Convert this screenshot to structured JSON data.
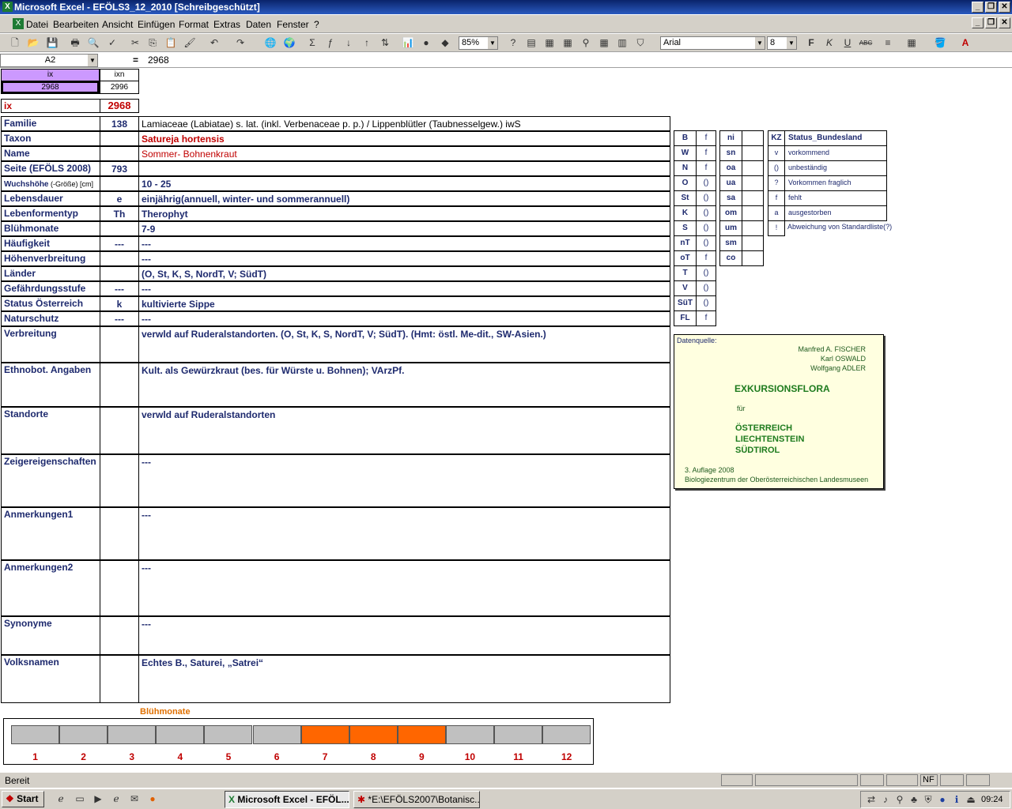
{
  "window": {
    "title": "Microsoft Excel - EFÖLS3_12_2010  [Schreibgeschützt]"
  },
  "menu": [
    "Datei",
    "Bearbeiten",
    "Ansicht",
    "Einfügen",
    "Format",
    "Extras",
    "Daten",
    "Fenster",
    "?"
  ],
  "toolbar": {
    "zoom": "85%",
    "font": "Arial",
    "size": "8"
  },
  "formula": {
    "cellref": "A2",
    "eq": "=",
    "value": "2968"
  },
  "header": {
    "ix_label": "ix",
    "ixn_label": "ixn",
    "ix_val": "2968",
    "ixn_val": "2996",
    "ix_row_label": "ix",
    "ix_row_val": "2968"
  },
  "rows": [
    {
      "label": "Familie",
      "code": "138",
      "value": "Lamiaceae (Labiatae) s. lat. (inkl. Verbenaceae p. p.)  /  Lippenblütler (Taubnesselgew.) iwS"
    },
    {
      "label": "Taxon",
      "code": "",
      "value": "Satureja hortensis"
    },
    {
      "label": "Name",
      "code": "",
      "value": "Sommer- Bohnenkraut"
    },
    {
      "label": "Seite (EFÖLS 2008)",
      "code": "793",
      "value": ""
    },
    {
      "label": "Wuchshöhe",
      "label_suffix": " (-Größe) [cm]",
      "code": "",
      "value": " 10 - 25"
    },
    {
      "label": "Lebensdauer",
      "code": "e",
      "value": "einjährig(annuell, winter- und sommerannuell)"
    },
    {
      "label": "Lebenformentyp",
      "code": "Th",
      "value": "Therophyt"
    },
    {
      "label": "Blühmonate",
      "code": "",
      "value": " 7-9"
    },
    {
      "label": "Häufigkeit",
      "code": "---",
      "value": " ---"
    },
    {
      "label": "Höhenverbreitung",
      "code": "",
      "value": " ---"
    },
    {
      "label": "Länder",
      "code": "",
      "value": "(O, St, K, S, NordT, V; SüdT)"
    },
    {
      "label": "Gefährdungsstufe",
      "code": "---",
      "value": "  ---"
    },
    {
      "label": "Status Österreich",
      "code": "k",
      "value": "kultivierte Sippe"
    },
    {
      "label": "Naturschutz",
      "code": "---",
      "value": " ---"
    },
    {
      "label": "Verbreitung",
      "code": "",
      "value": "verwld auf Ruderalstandorten. (O, St, K, S, NordT, V; SüdT). (Hmt: östl. Me-dit., SW-Asien.)"
    },
    {
      "label": "Ethnobot. Angaben",
      "code": "",
      "value": "Kult. als Gewürzkraut (bes. für Würste u. Bohnen);  VArzPf."
    },
    {
      "label": "Standorte",
      "code": "",
      "value": "verwld auf Ruderalstandorten"
    },
    {
      "label": "Zeigereigenschaften",
      "code": "",
      "value": "---"
    },
    {
      "label": "Anmerkungen1",
      "code": "",
      "value": "---"
    },
    {
      "label": "Anmerkungen2",
      "code": "",
      "value": "---"
    },
    {
      "label": "Synonyme",
      "code": "",
      "value": "---"
    },
    {
      "label": "Volksnamen",
      "code": "",
      "value": "Echtes B., Saturei, „Satrei“"
    }
  ],
  "laender": [
    {
      "k": "B",
      "v": "f"
    },
    {
      "k": "W",
      "v": "f"
    },
    {
      "k": "N",
      "v": "f"
    },
    {
      "k": "O",
      "v": "()"
    },
    {
      "k": "St",
      "v": "()"
    },
    {
      "k": "K",
      "v": "()"
    },
    {
      "k": "S",
      "v": "()"
    },
    {
      "k": "nT",
      "v": "()"
    },
    {
      "k": "oT",
      "v": "f"
    },
    {
      "k": "T",
      "v": "()"
    },
    {
      "k": "V",
      "v": "()"
    },
    {
      "k": "SüT",
      "v": "()"
    },
    {
      "k": "FL",
      "v": "f"
    }
  ],
  "hoehen": [
    "ni",
    "sn",
    "oa",
    "ua",
    "sa",
    "om",
    "um",
    "sm",
    "co"
  ],
  "status": {
    "kz": "KZ",
    "title": "Status_Bundesland",
    "items": [
      {
        "k": "v",
        "v": "vorkommend"
      },
      {
        "k": "()",
        "v": "unbeständig"
      },
      {
        "k": "?",
        "v": "Vorkommen fraglich"
      },
      {
        "k": "f",
        "v": "fehlt"
      },
      {
        "k": "a",
        "v": "ausgestorben"
      },
      {
        "k": "!",
        "v": "Abweichung von Standardliste(?)"
      }
    ]
  },
  "source": {
    "label": "Datenquelle:",
    "a1": "Manfred A. FISCHER",
    "a2": "Karl OSWALD",
    "a3": "Wolfgang ADLER",
    "title": "EXKURSIONSFLORA",
    "fuer": "für",
    "c1": "ÖSTERREICH",
    "c2": "LIECHTENSTEIN",
    "c3": "SÜDTIROL",
    "ed": "3. Auflage 2008",
    "pub": "Biologiezentrum der Oberösterreichischen Landesmuseen"
  },
  "months": {
    "title": "Blühmonate",
    "labels": [
      "1",
      "2",
      "3",
      "4",
      "5",
      "6",
      "7",
      "8",
      "9",
      "10",
      "11",
      "12"
    ],
    "active": [
      7,
      8,
      9
    ],
    "active_color": "#ff6600",
    "inactive_color": "#c0c0c0"
  },
  "status_bar": {
    "text": "Bereit",
    "nf": "NF"
  },
  "taskbar": {
    "start": "Start",
    "task1": "Microsoft Excel - EFÖL...",
    "task2": "*E:\\EFÖLS2007\\Botanisc...",
    "clock": "09:24"
  }
}
